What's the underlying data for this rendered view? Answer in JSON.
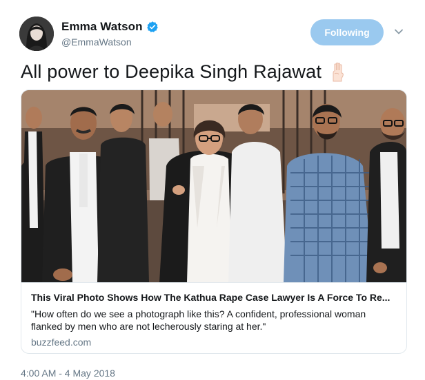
{
  "user": {
    "display_name": "Emma Watson",
    "handle": "@EmmaWatson"
  },
  "follow_button": {
    "label": "Following"
  },
  "tweet": {
    "text": "All power to Deepika Singh Rajawat",
    "emoji": "raised-fist-emoji",
    "timestamp": "4:00 AM - 4 May 2018"
  },
  "card": {
    "title": "This Viral Photo Shows How The Kathua Rape Case Lawyer Is A Force To Re...",
    "description": "\"How often do we see a photograph like this? A confident, professional woman flanked by men who are not lecherously staring at her.\"",
    "domain": "buzzfeed.com"
  },
  "colors": {
    "accent": "#1da1f2",
    "follow_button_bg": "#9ac9ef",
    "secondary_text": "#657786",
    "border": "#e1e8ed"
  },
  "icons": [
    "verified-badge-icon",
    "chevron-down-icon",
    "raised-fist-emoji"
  ]
}
